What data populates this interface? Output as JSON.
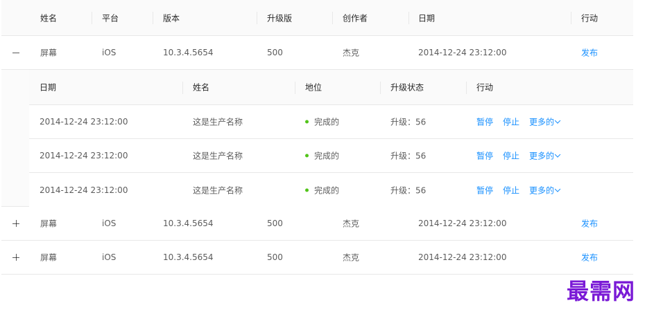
{
  "table": {
    "headers": [
      "姓名",
      "平台",
      "版本",
      "升级版",
      "创作者",
      "日期",
      "行动"
    ],
    "rows": [
      {
        "expand": "−",
        "name": "屏幕",
        "platform": "iOS",
        "version": "10.3.4.5654",
        "upgrade": "500",
        "creator": "杰克",
        "date": "2014-12-24 23:12:00",
        "action": "发布"
      },
      {
        "expand": "+",
        "name": "屏幕",
        "platform": "iOS",
        "version": "10.3.4.5654",
        "upgrade": "500",
        "creator": "杰克",
        "date": "2014-12-24 23:12:00",
        "action": "发布"
      },
      {
        "expand": "+",
        "name": "屏幕",
        "platform": "iOS",
        "version": "10.3.4.5654",
        "upgrade": "500",
        "creator": "杰克",
        "date": "2014-12-24 23:12:00",
        "action": "发布"
      }
    ]
  },
  "nested": {
    "headers": [
      "日期",
      "姓名",
      "地位",
      "升级状态",
      "行动"
    ],
    "rows": [
      {
        "date": "2014-12-24 23:12:00",
        "name": "这是生产名称",
        "status": "完成的",
        "upgrade": "升级：56",
        "pause": "暂停",
        "stop": "停止",
        "more": "更多的"
      },
      {
        "date": "2014-12-24 23:12:00",
        "name": "这是生产名称",
        "status": "完成的",
        "upgrade": "升级：56",
        "pause": "暂停",
        "stop": "停止",
        "more": "更多的"
      },
      {
        "date": "2014-12-24 23:12:00",
        "name": "这是生产名称",
        "status": "完成的",
        "upgrade": "升级：56",
        "pause": "暂停",
        "stop": "停止",
        "more": "更多的"
      }
    ]
  },
  "colors": {
    "link": "#1890ff",
    "status_success": "#52c41a",
    "border": "#e8e8e8",
    "header_bg": "#fafafa",
    "watermark": "#7a1ad6"
  },
  "watermark": "最需网"
}
